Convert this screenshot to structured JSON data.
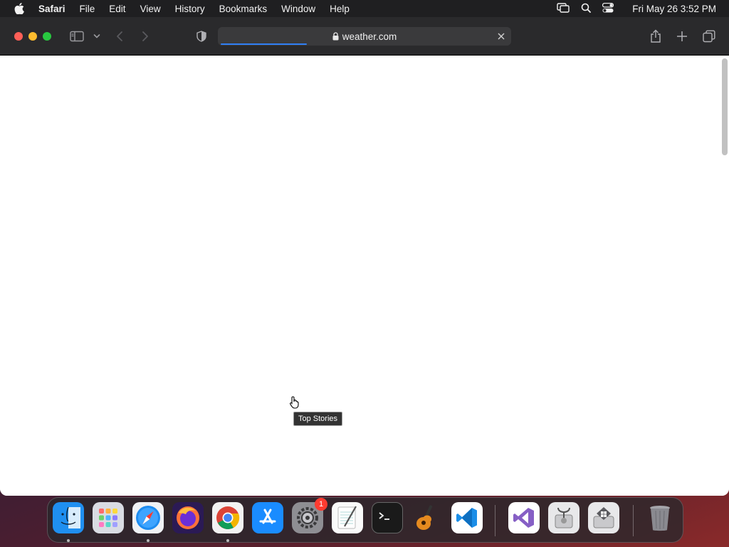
{
  "menubar": {
    "app_name": "Safari",
    "items": [
      "File",
      "Edit",
      "View",
      "History",
      "Bookmarks",
      "Window",
      "Help"
    ],
    "datetime": "Fri May 26  3:52 PM"
  },
  "browser": {
    "address": "weather.com",
    "tooltip": "Top Stories",
    "load_progress_percent": 30
  },
  "dock": {
    "apps": [
      "Finder",
      "Launchpad",
      "Safari",
      "Firefox",
      "Chrome",
      "App Store",
      "System Preferences",
      "TextEdit",
      "Terminal",
      "GarageBand",
      "Visual Studio Code",
      "Visual Studio",
      "Disk Utility",
      "Boot Camp Assistant",
      "Trash"
    ],
    "settings_badge": "1"
  }
}
